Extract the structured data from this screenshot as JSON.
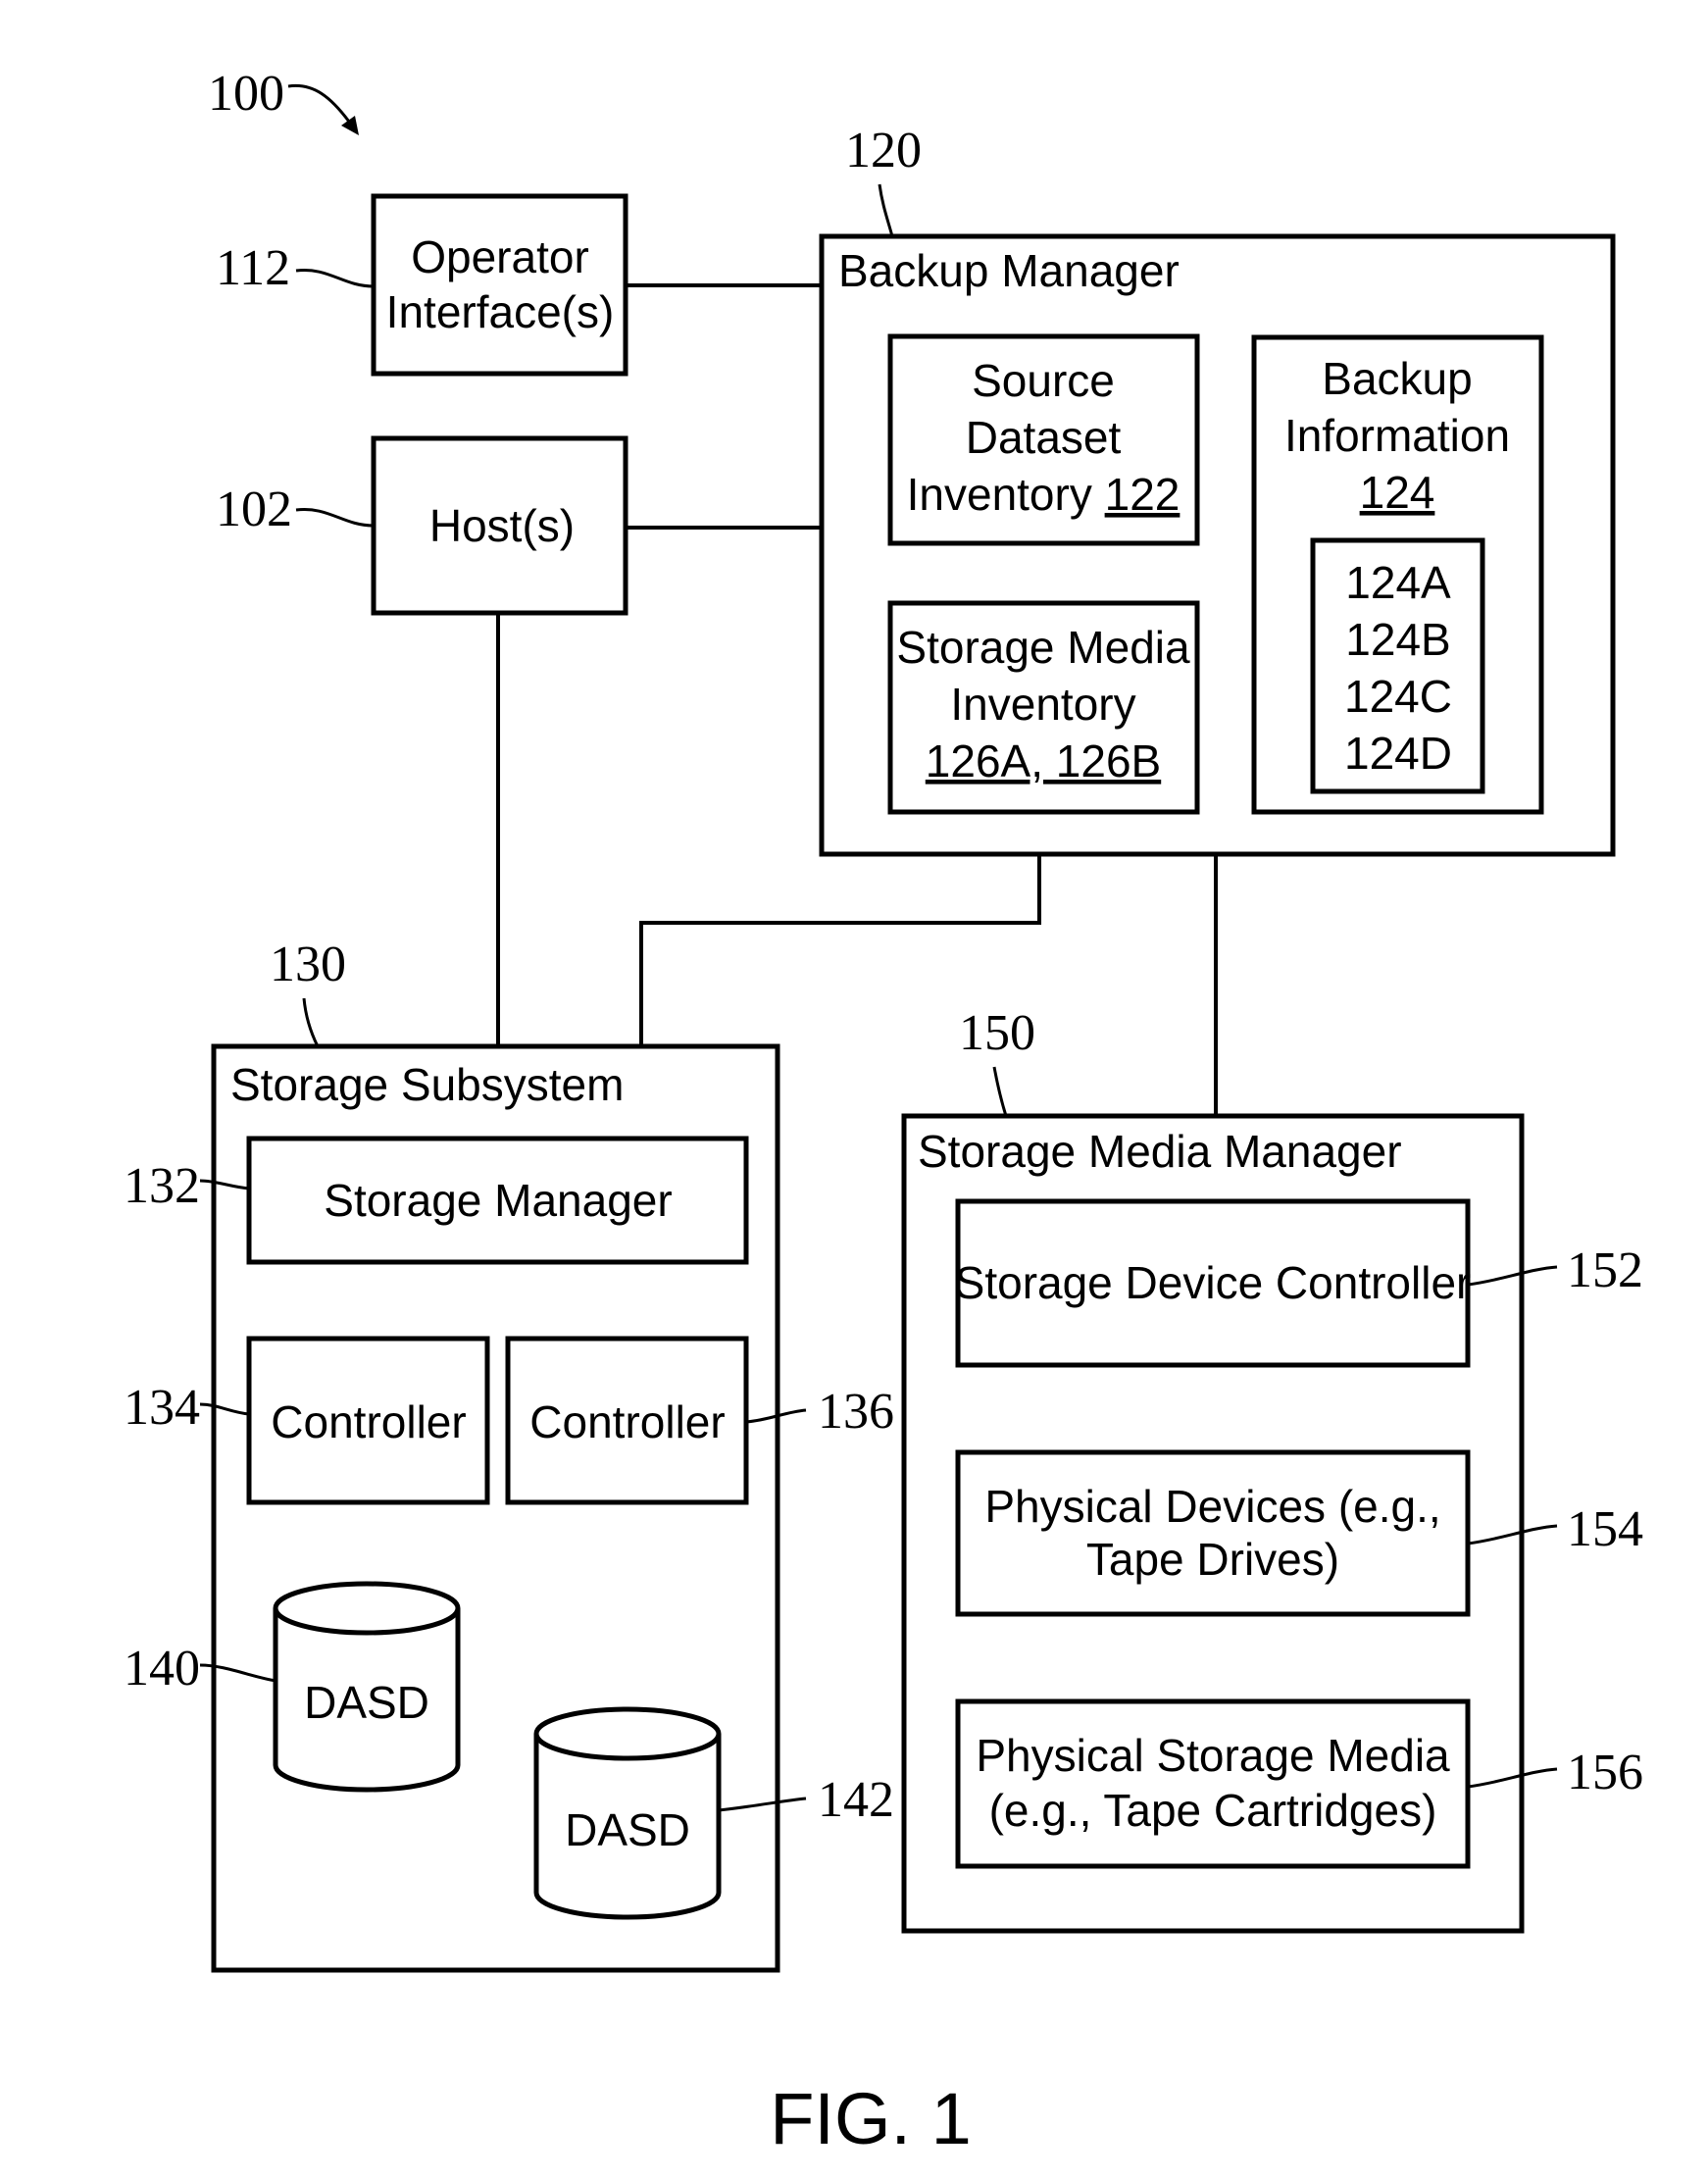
{
  "figure": {
    "caption": "FIG. 1",
    "system_ref": "100"
  },
  "operator_interface": {
    "ref": "112",
    "lines": [
      "Operator",
      "Interface(s)"
    ]
  },
  "host": {
    "ref": "102",
    "label": "Host(s)"
  },
  "backup_manager": {
    "ref": "120",
    "title": "Backup Manager",
    "source_dataset_inventory": {
      "lines": [
        "Source",
        "Dataset",
        "Inventory"
      ],
      "ref": "122"
    },
    "storage_media_inventory": {
      "lines": [
        "Storage Media",
        "Inventory"
      ],
      "ref": "126A, 126B"
    },
    "backup_information": {
      "lines": [
        "Backup",
        "Information"
      ],
      "ref": "124",
      "items": [
        "124A",
        "124B",
        "124C",
        "124D"
      ]
    }
  },
  "storage_subsystem": {
    "ref": "130",
    "title": "Storage Subsystem",
    "storage_manager": {
      "ref": "132",
      "label": "Storage Manager"
    },
    "controller_a": {
      "ref": "134",
      "label": "Controller"
    },
    "controller_b": {
      "ref": "136",
      "label": "Controller"
    },
    "dasd_a": {
      "ref": "140",
      "label": "DASD"
    },
    "dasd_b": {
      "ref": "142",
      "label": "DASD"
    }
  },
  "storage_media_manager": {
    "ref": "150",
    "title": "Storage Media Manager",
    "storage_device_controller": {
      "ref": "152",
      "lines": [
        "Storage Device Controller"
      ]
    },
    "physical_devices": {
      "ref": "154",
      "lines": [
        "Physical Devices (e.g.,",
        "Tape Drives)"
      ]
    },
    "physical_storage_media": {
      "ref": "156",
      "lines": [
        "Physical Storage Media",
        "(e.g., Tape Cartridges)"
      ]
    }
  }
}
